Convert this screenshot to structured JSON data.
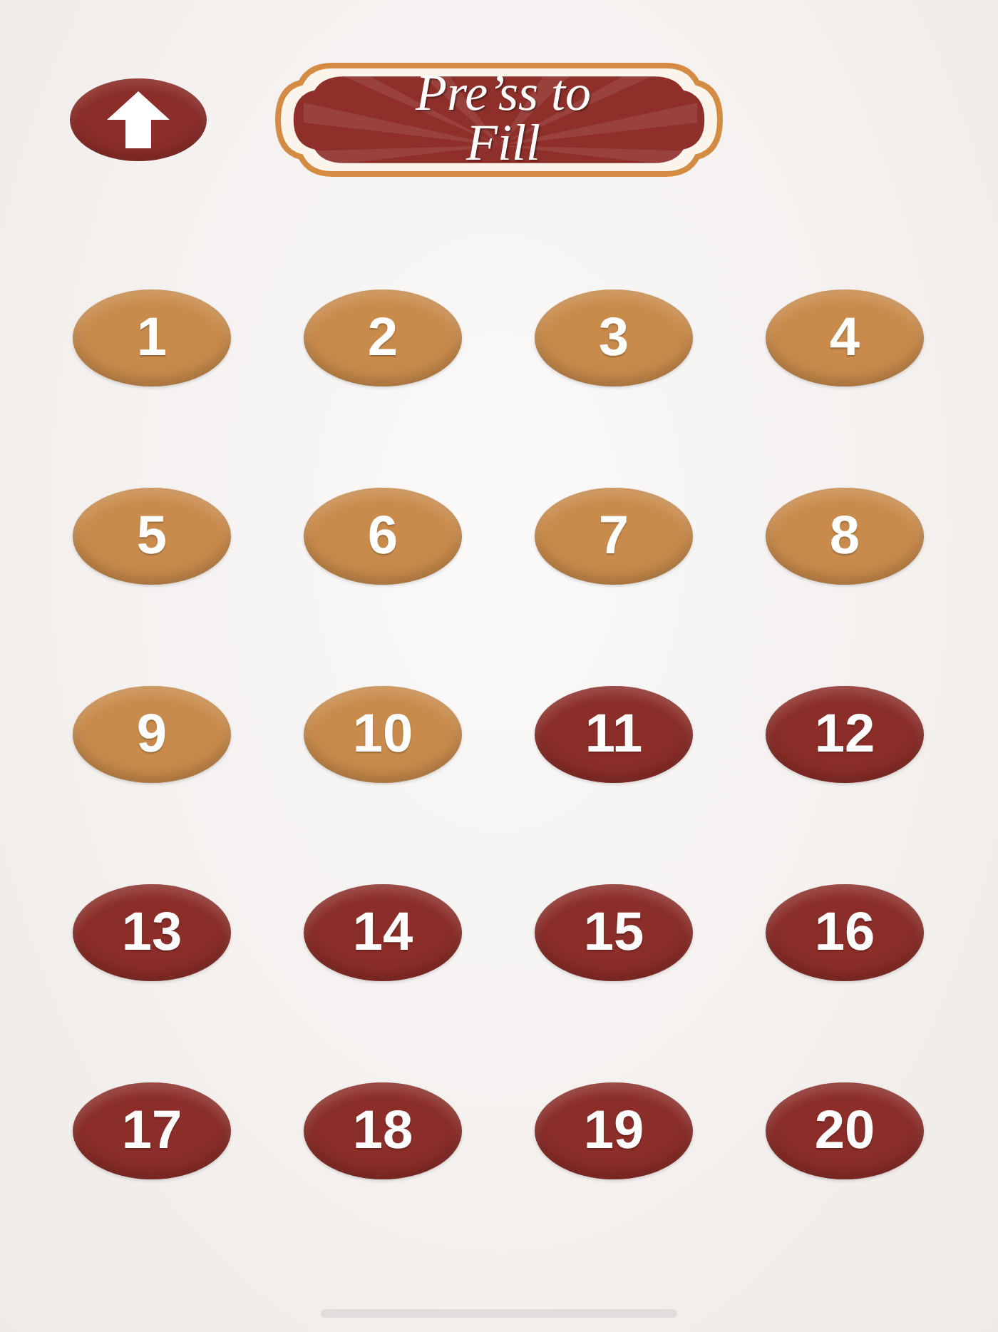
{
  "logo": {
    "text": "Pre’ss to Fill"
  },
  "buttons": [
    {
      "label": "1",
      "color": "#c98b4b"
    },
    {
      "label": "2",
      "color": "#c98b4b"
    },
    {
      "label": "3",
      "color": "#c98b4b"
    },
    {
      "label": "4",
      "color": "#c98b4b"
    },
    {
      "label": "5",
      "color": "#c98b4b"
    },
    {
      "label": "6",
      "color": "#c98b4b"
    },
    {
      "label": "7",
      "color": "#c98b4b"
    },
    {
      "label": "8",
      "color": "#c98b4b"
    },
    {
      "label": "9",
      "color": "#c98b4b"
    },
    {
      "label": "10",
      "color": "#c98b4b"
    },
    {
      "label": "11",
      "color": "#8b2d28"
    },
    {
      "label": "12",
      "color": "#8b2d28"
    },
    {
      "label": "13",
      "color": "#8b2d28"
    },
    {
      "label": "14",
      "color": "#8b2d28"
    },
    {
      "label": "15",
      "color": "#8b2d28"
    },
    {
      "label": "16",
      "color": "#8b2d28"
    },
    {
      "label": "17",
      "color": "#8b2d28"
    },
    {
      "label": "18",
      "color": "#8b2d28"
    },
    {
      "label": "19",
      "color": "#8b2d28"
    },
    {
      "label": "20",
      "color": "#8b2d28"
    }
  ]
}
